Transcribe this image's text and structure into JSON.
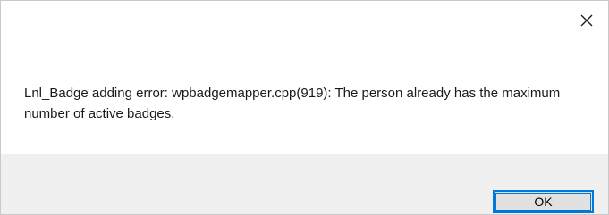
{
  "dialog": {
    "message": "Lnl_Badge adding error: wpbadgemapper.cpp(919): The person already has the maximum number of active badges.",
    "ok_label": "OK",
    "close_icon": "close-icon"
  },
  "colors": {
    "background": "#ffffff",
    "footer": "#f0f0f0",
    "button_face": "#e1e1e1",
    "focus_border": "#0078d7",
    "text": "#1a1a1a"
  }
}
